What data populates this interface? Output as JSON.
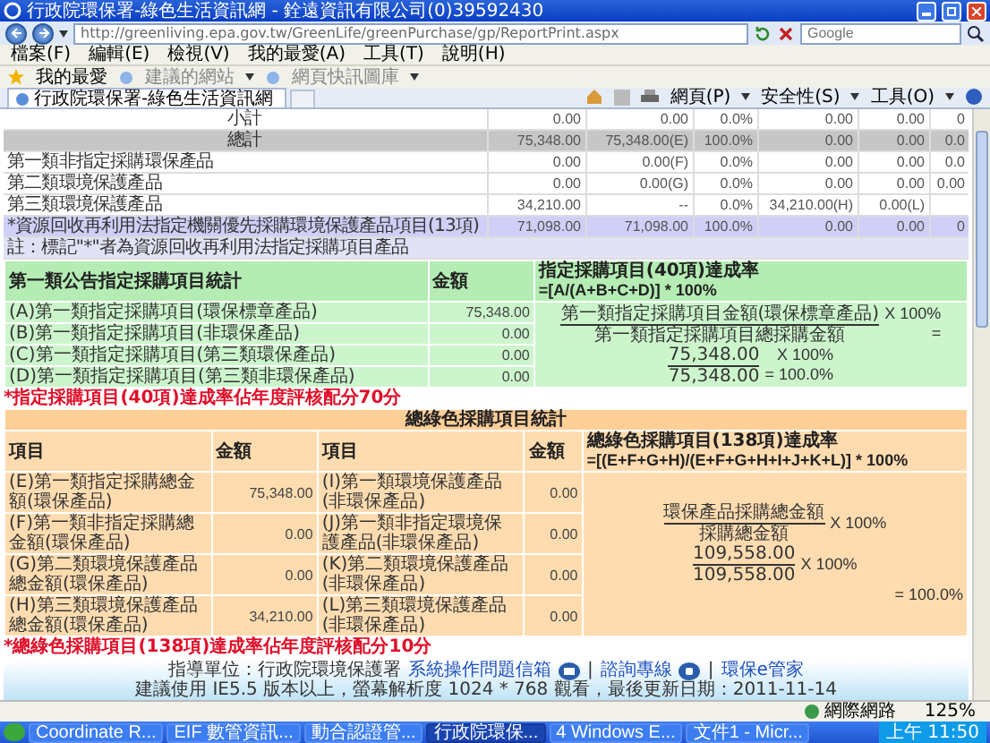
{
  "browser": {
    "title": "行政院環保署-綠色生活資訊網 - 銓遠資訊有限公司(0)39592430",
    "address": "http://greenliving.epa.gov.tw/GreenLife/greenPurchase/gp/ReportPrint.aspx",
    "search_placeholder": "Google",
    "menu": [
      "檔案(F)",
      "編輯(E)",
      "檢視(V)",
      "我的最愛(A)",
      "工具(T)",
      "說明(H)"
    ],
    "favorites": {
      "label": "我的最愛",
      "links": [
        "建議的網站",
        "網頁快訊圖庫"
      ]
    },
    "tab": {
      "label": "行政院環保署-綠色生活資訊網"
    },
    "commands": [
      "網頁(P)",
      "安全性(S)",
      "工具(O)"
    ],
    "status": {
      "zone": "網際網路",
      "zoom": "125%"
    }
  },
  "summary": {
    "rows": [
      {
        "kind": "subtotal",
        "label": "小計",
        "values": [
          "0.00",
          "0.00",
          "0.0%",
          "0.00",
          "0.00",
          "0"
        ]
      },
      {
        "kind": "total",
        "label": "總計",
        "values": [
          "75,348.00",
          "75,348.00(E)",
          "100.0%",
          "0.00",
          "0.00",
          "0.0"
        ]
      },
      {
        "kind": "item",
        "label": "第一類非指定採購環保產品",
        "values": [
          "0.00",
          "0.00(F)",
          "0.0%",
          "0.00",
          "0.00",
          "0.0"
        ]
      },
      {
        "kind": "item",
        "label": "第二類環境保護產品",
        "values": [
          "0.00",
          "0.00(G)",
          "0.0%",
          "0.00",
          "0.00",
          "0.00"
        ]
      },
      {
        "kind": "item",
        "label": "第三類環境保護產品",
        "values": [
          "34,210.00",
          "--",
          "0.0%",
          "34,210.00(H)",
          "0.00(L)"
        ]
      },
      {
        "kind": "featured",
        "label": "*資源回收再利用法指定機關優先採購環境保護產品項目(13項)",
        "values": [
          "71,098.00",
          "71,098.00",
          "100.0%",
          "0.00",
          "0.00",
          "0"
        ]
      },
      {
        "kind": "note",
        "label": "註：標記\"*\"者為資源回收再利用法指定採購項目產品"
      }
    ]
  },
  "designated": {
    "headers": [
      "第一類公告指定採購項目統計",
      "金額"
    ],
    "formula_title": "指定採購項目(40項)達成率",
    "formula_expression": "=[A/(A+B+C+D)] * 100%",
    "rows": [
      {
        "label": "(A)第一類指定採購項目(環保標章產品)",
        "amount": "75,348.00"
      },
      {
        "label": "(B)第一類指定採購項目(非環保產品)",
        "amount": "0.00"
      },
      {
        "label": "(C)第一類指定採購項目(第三類環保產品)",
        "amount": "0.00"
      },
      {
        "label": "(D)第一類指定採購項目(第三類非環保產品)",
        "amount": "0.00"
      }
    ],
    "formula": [
      {
        "kind": "fraction",
        "numerator": "第一類指定採購項目金額(環保標章產品)",
        "denominator": "第一類指定採購項目總採購金額",
        "factor": "X 100%",
        "after": "="
      },
      {
        "kind": "fraction",
        "numerator": "75,348.00",
        "denominator": "75,348.00",
        "factor": "X 100%",
        "after": "= 100.0%"
      }
    ],
    "note": "*指定採購項目(40項)達成率佔年度評核配分70分"
  },
  "green": {
    "title": "總綠色採購項目統計",
    "headers": [
      "項目",
      "金額",
      "項目",
      "金額"
    ],
    "formula_title": "總綠色採購項目(138項)達成率",
    "formula_expression": "=[(E+F+G+H)/(E+F+G+H+I+J+K+L)] * 100%",
    "rows": [
      {
        "label": "(E)第一類指定採購總金額(環保產品)",
        "amount": "75,348.00",
        "label_2": "(I)第一類環境保護產品(非環保產品)",
        "amount_2": "0.00"
      },
      {
        "label": "(F)第一類非指定採購總金額(環保產品)",
        "amount": "0.00",
        "label_2": "(J)第一類非指定環境保護產品(非環保產品)",
        "amount_2": "0.00"
      },
      {
        "label": "(G)第二類環境保護產品總金額(環保產品)",
        "amount": "0.00",
        "label_2": "(K)第二類環境保護產品(非環保產品)",
        "amount_2": "0.00"
      },
      {
        "label": "(H)第三類環境保護產品總金額(環保產品)",
        "amount": "34,210.00",
        "label_2": "(L)第三類環境保護產品(非環保產品)",
        "amount_2": "0.00"
      }
    ],
    "formula": [
      {
        "kind": "fraction",
        "numerator": "環保產品採購總金額",
        "denominator": "採購總金額",
        "factor": "X 100%"
      },
      {
        "kind": "fraction",
        "numerator": "109,558.00",
        "denominator": "109,558.00",
        "factor": "X 100%"
      },
      {
        "kind": "text",
        "text": "= 100.0%"
      }
    ],
    "note": "*總綠色採購項目(138項)達成率佔年度評核配分10分"
  },
  "footer": {
    "sponsor": "指導單位：行政院環境保護署",
    "links": [
      "系統操作問題信箱",
      "諮詢專線",
      "環保e管家"
    ],
    "separators": [
      "|",
      "|"
    ],
    "info": "建議使用 IE5.5 版本以上，螢幕解析度 1024 * 768 觀看，最後更新日期：2011-11-14"
  },
  "taskbar": {
    "items": [
      {
        "label": "Coordinate R...",
        "selected": false
      },
      {
        "label": "EIF 數管資訊...",
        "selected": false
      },
      {
        "label": "動合認證管...",
        "selected": false
      },
      {
        "label": "行政院環保...",
        "selected": true
      },
      {
        "label": "4 Windows E...",
        "selected": false
      },
      {
        "label": "文件1 - Micr...",
        "selected": false
      }
    ],
    "clock": "上午 11:50"
  }
}
